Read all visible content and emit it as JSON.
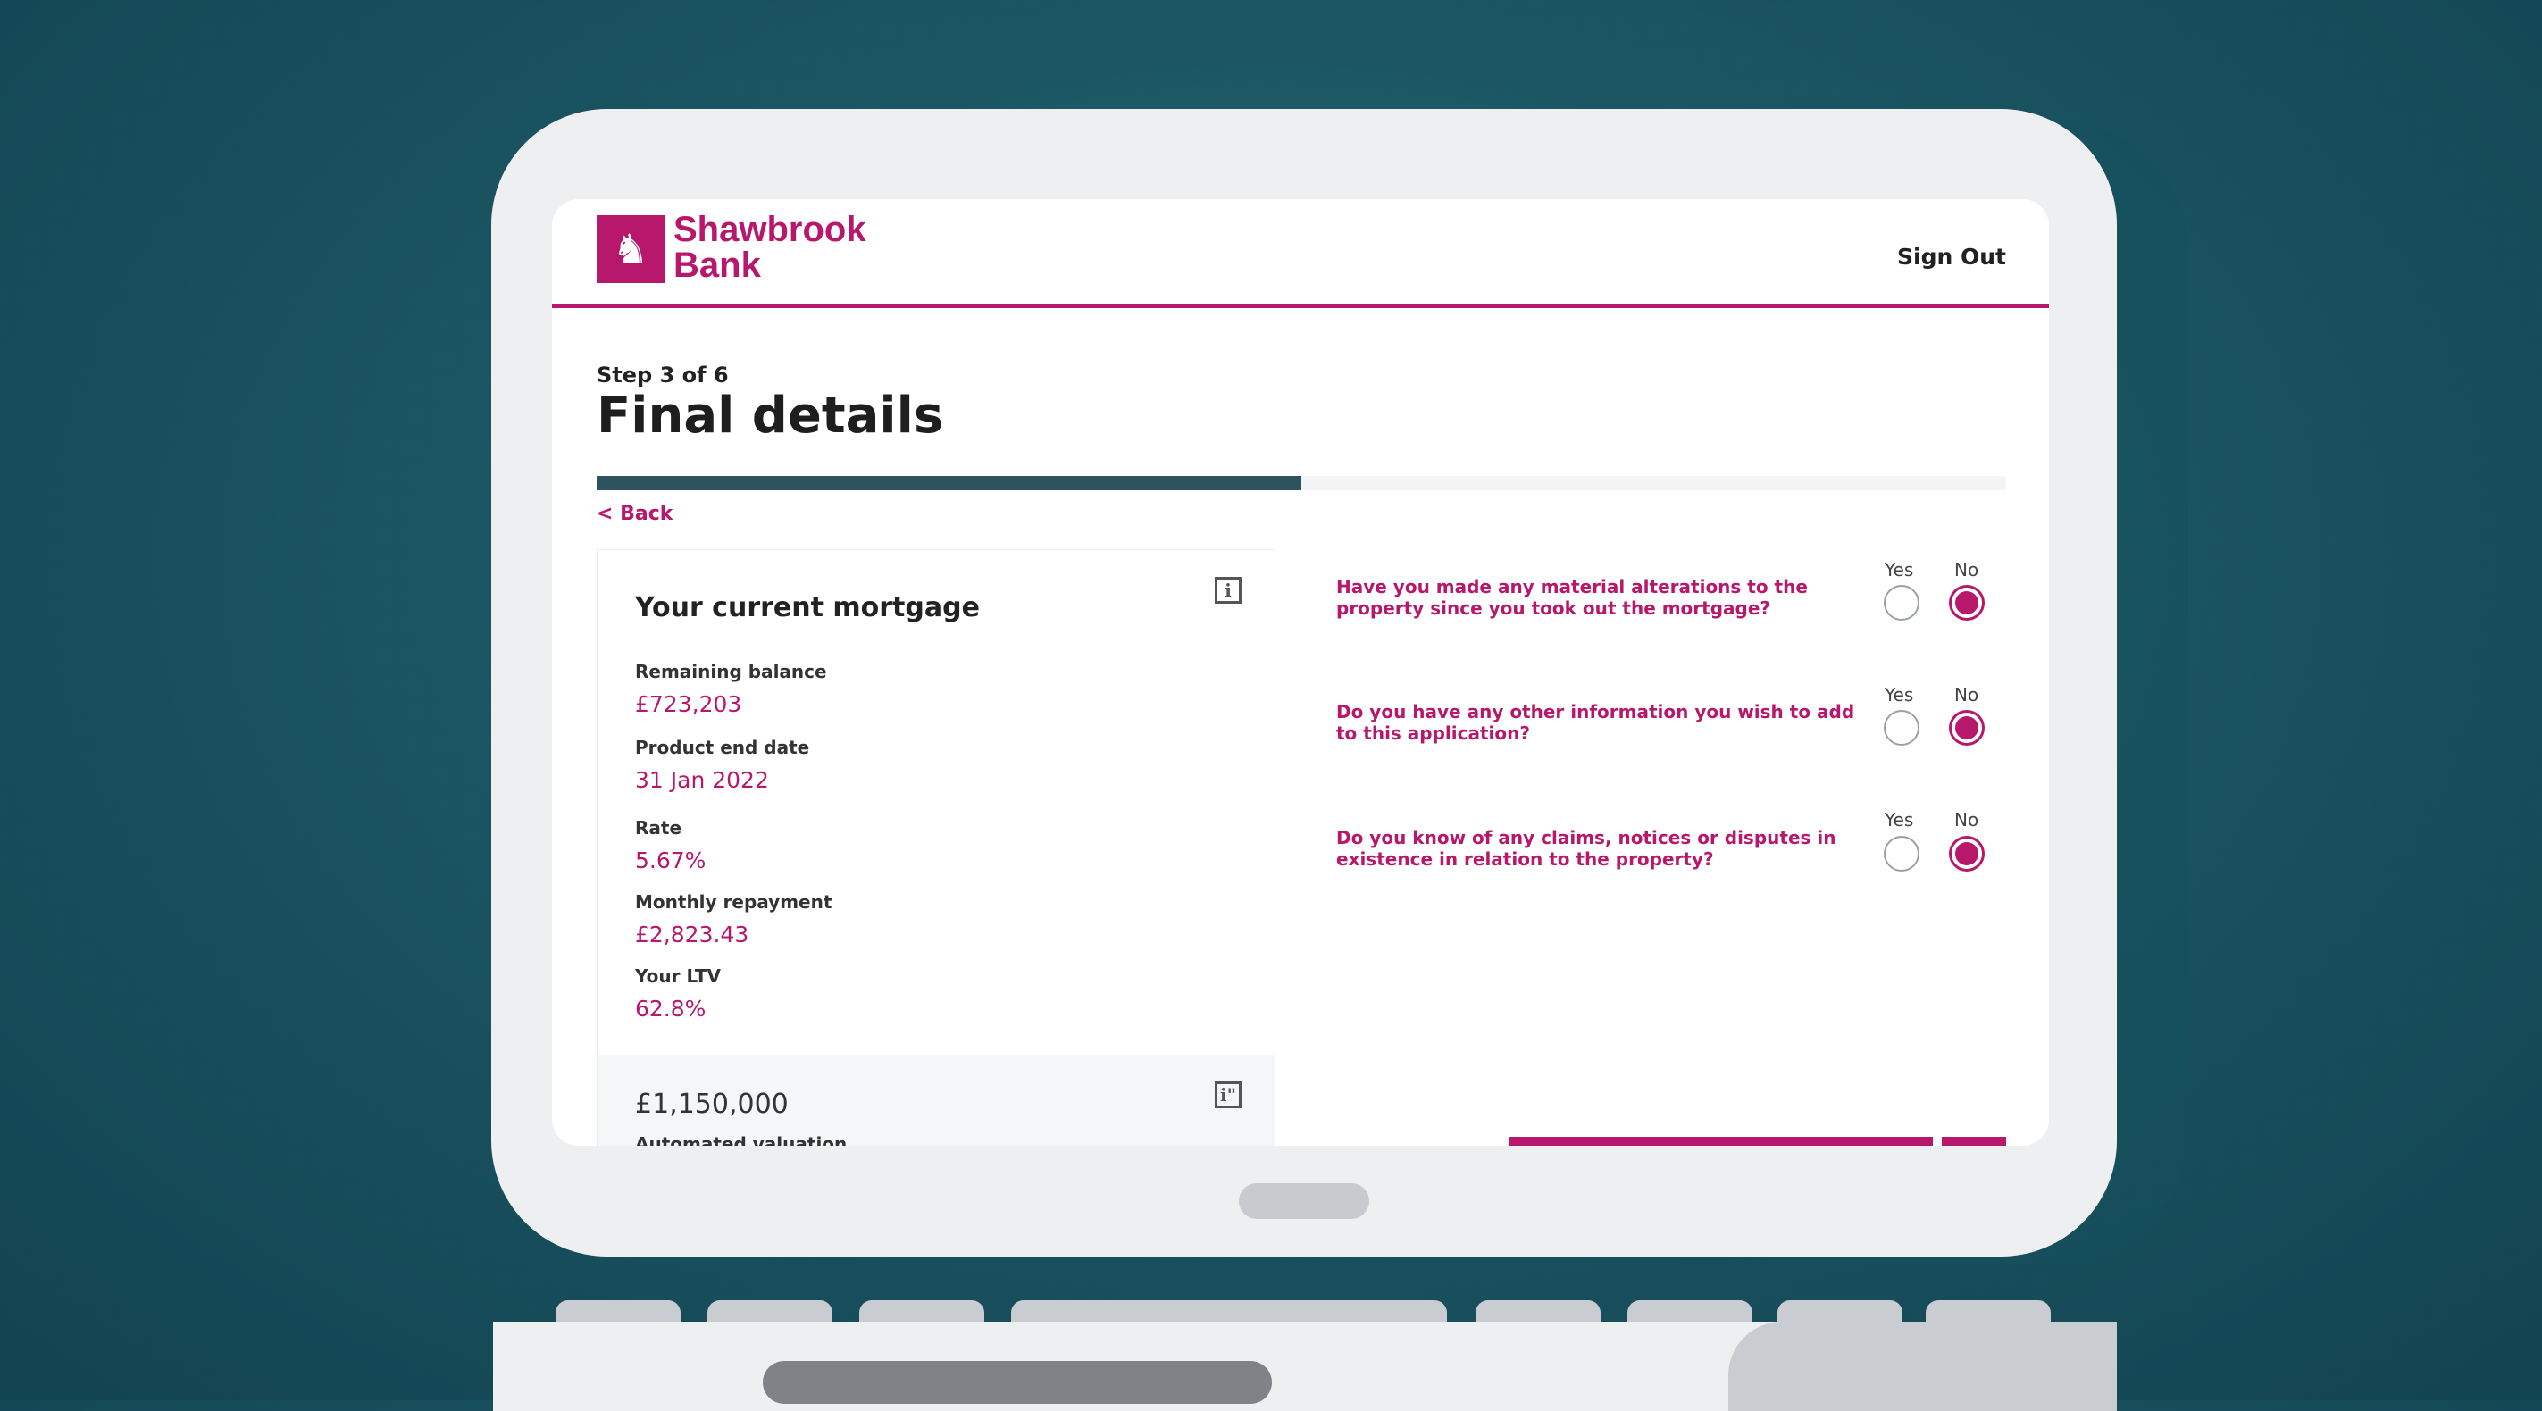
{
  "header": {
    "brand_line1": "Shawbrook",
    "brand_line2": "Bank",
    "sign_out": "Sign Out"
  },
  "page": {
    "step": "Step 3 of 6",
    "title": "Final details",
    "back": "< Back",
    "progress_fraction": 0.5
  },
  "mortgage_card": {
    "title": "Your current mortgage",
    "fields": [
      {
        "label": "Remaining balance",
        "value": "£723,203"
      },
      {
        "label": "Product end date",
        "value": "31 Jan 2022"
      },
      {
        "label": "Rate",
        "value": "5.67%"
      },
      {
        "label": "Monthly repayment",
        "value": "£2,823.43"
      },
      {
        "label": "Your LTV",
        "value": "62.8%"
      }
    ],
    "valuation_amount": "£1,150,000",
    "valuation_label": "Automated valuation"
  },
  "questions": [
    {
      "text": "Have you made any material alterations to the property since you took out the mortgage?",
      "yes": "Yes",
      "no": "No",
      "selected": "No"
    },
    {
      "text": "Do you have any other information you wish to add to this application?",
      "yes": "Yes",
      "no": "No",
      "selected": "No"
    },
    {
      "text": "Do you know of any claims, notices or disputes in existence in relation to the property?",
      "yes": "Yes",
      "no": "No",
      "selected": "No"
    }
  ],
  "colors": {
    "brand": "#b8186c",
    "progress": "#2d5260",
    "background": "#1b5563"
  },
  "icons": [
    "lion-logo-icon",
    "info-icon"
  ]
}
